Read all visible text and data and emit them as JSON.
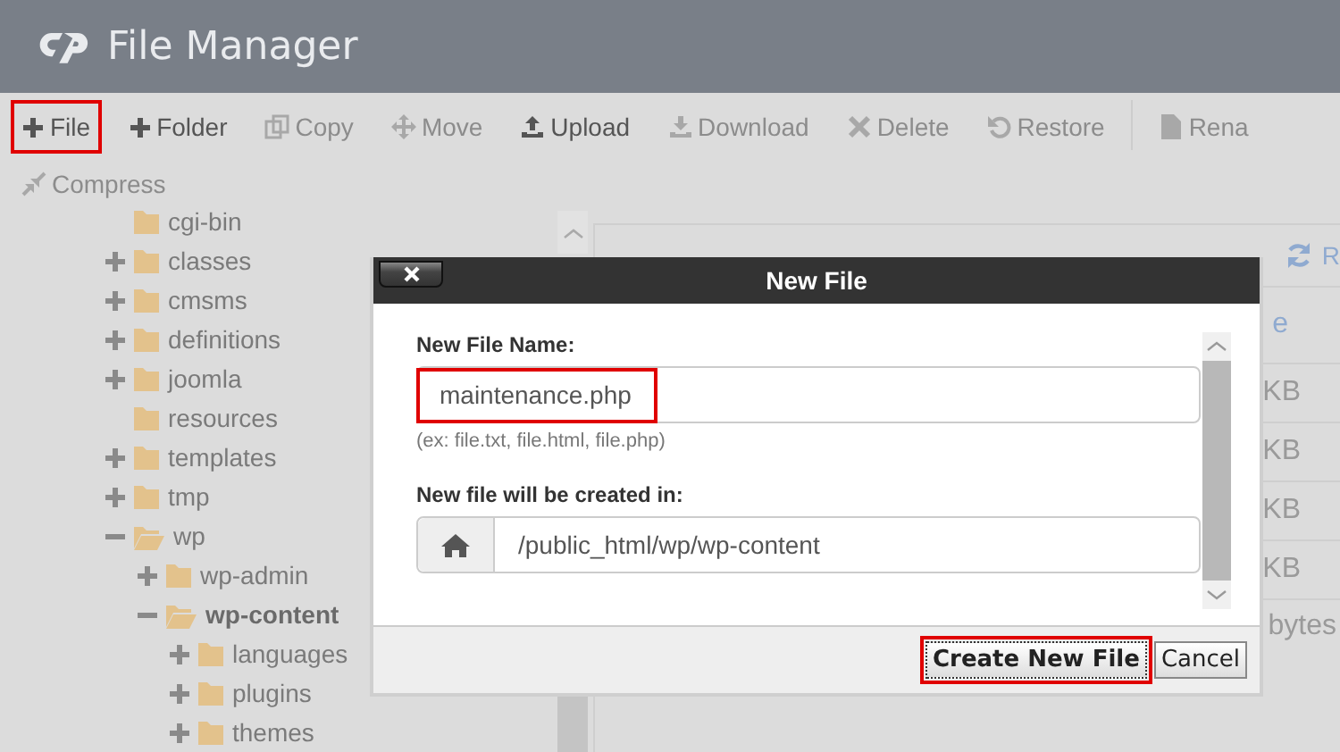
{
  "app": {
    "title": "File Manager"
  },
  "toolbar": [
    {
      "label": "File",
      "disabled": false,
      "highlighted": true
    },
    {
      "label": "Folder",
      "disabled": false,
      "highlighted": false
    },
    {
      "label": "Copy",
      "disabled": true,
      "highlighted": false
    },
    {
      "label": "Move",
      "disabled": true,
      "highlighted": false
    },
    {
      "label": "Upload",
      "disabled": false,
      "highlighted": false
    },
    {
      "label": "Download",
      "disabled": true,
      "highlighted": false
    },
    {
      "label": "Delete",
      "disabled": true,
      "highlighted": false
    },
    {
      "label": "Restore",
      "disabled": true,
      "highlighted": false
    },
    {
      "label": "Rena",
      "disabled": true,
      "highlighted": false
    },
    {
      "label": "Compress",
      "disabled": true,
      "highlighted": false
    }
  ],
  "tree": [
    {
      "label": "cgi-bin",
      "kind": "leaf",
      "selected": false
    },
    {
      "label": "classes",
      "kind": "branch",
      "expanded": false,
      "selected": false
    },
    {
      "label": "cmsms",
      "kind": "branch",
      "expanded": false,
      "selected": false
    },
    {
      "label": "definitions",
      "kind": "branch",
      "expanded": false,
      "selected": false
    },
    {
      "label": "joomla",
      "kind": "branch",
      "expanded": false,
      "selected": false
    },
    {
      "label": "resources",
      "kind": "leaf",
      "selected": false
    },
    {
      "label": "templates",
      "kind": "branch",
      "expanded": false,
      "selected": false
    },
    {
      "label": "tmp",
      "kind": "branch",
      "expanded": false,
      "selected": false
    },
    {
      "label": "wp",
      "kind": "branch",
      "expanded": true,
      "selected": false,
      "children": [
        {
          "label": "wp-admin",
          "kind": "branch",
          "expanded": false,
          "selected": false
        },
        {
          "label": "wp-content",
          "kind": "branch",
          "expanded": true,
          "selected": true,
          "children": [
            {
              "label": "languages",
              "kind": "branch",
              "expanded": false,
              "selected": false
            },
            {
              "label": "plugins",
              "kind": "branch",
              "expanded": false,
              "selected": false
            },
            {
              "label": "themes",
              "kind": "branch",
              "expanded": false,
              "selected": false
            }
          ]
        }
      ]
    }
  ],
  "nav": [
    {
      "label": "R"
    }
  ],
  "table": {
    "columns": [
      "e"
    ],
    "rows": [
      {
        "column_1": "KB"
      },
      {
        "column_1": "KB"
      },
      {
        "column_1": "KB"
      },
      {
        "column_1": "KB"
      }
    ],
    "summary": "bytes"
  },
  "dialog": {
    "title": "New File",
    "name_label": "New File Name:",
    "name_value": "maintenance.php",
    "name_highlighted": true,
    "hint": "(ex: file.txt, file.html, file.php)",
    "location_label": "New file will be created in:",
    "location_value": "/public_html/wp/wp-content",
    "buttons": [
      {
        "label": "Create New File",
        "highlighted": true
      },
      {
        "label": "Cancel",
        "highlighted": false
      }
    ]
  }
}
